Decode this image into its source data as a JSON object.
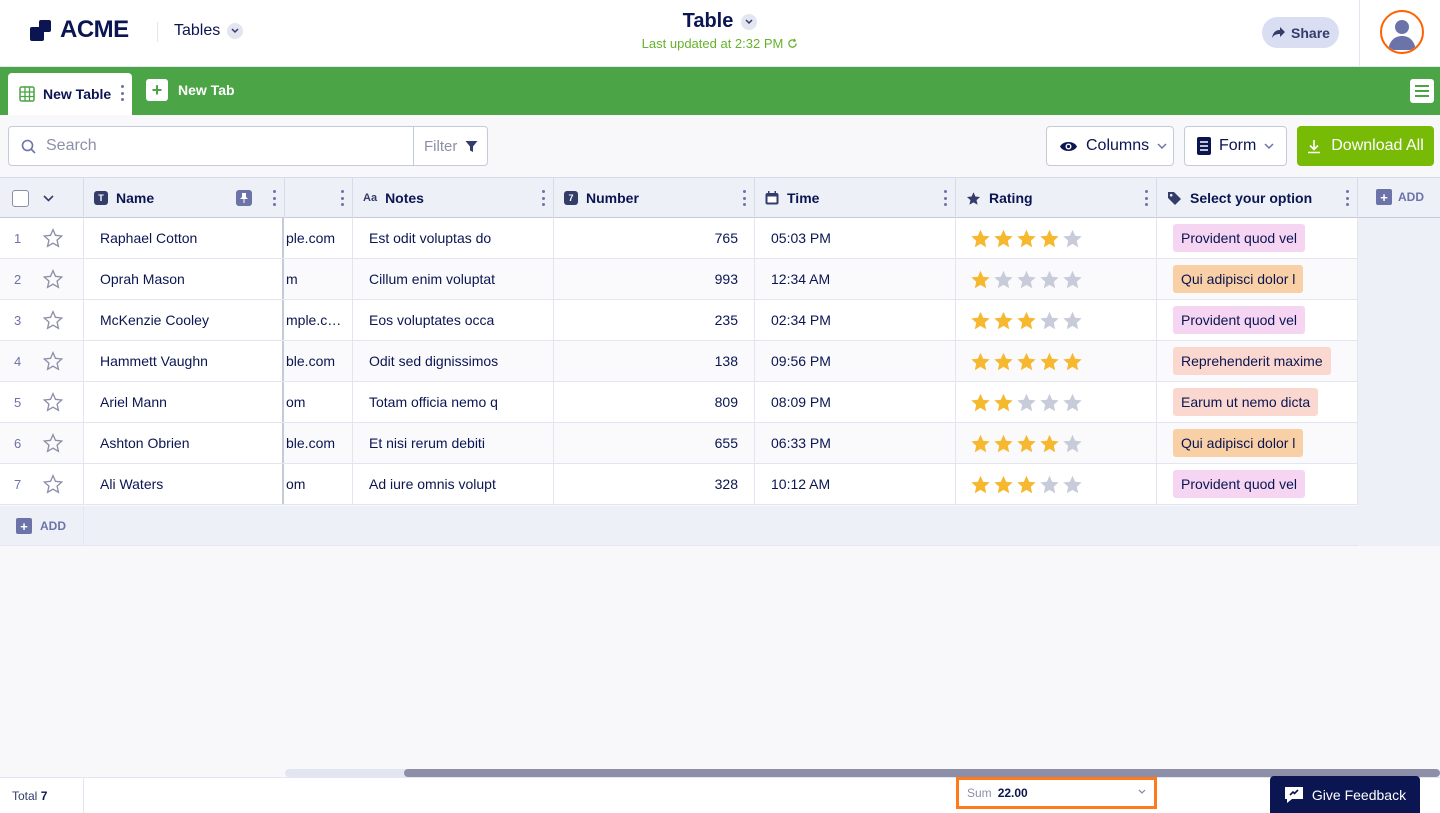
{
  "app": {
    "brand": "ACME",
    "section_label": "Tables",
    "title": "Table",
    "last_updated": "Last updated at 2:32 PM",
    "share_label": "Share"
  },
  "tabs": {
    "active_label": "New Table",
    "new_tab_label": "New Tab"
  },
  "toolbar": {
    "search_placeholder": "Search",
    "filter_label": "Filter",
    "columns_label": "Columns",
    "form_label": "Form",
    "download_label": "Download All"
  },
  "columns": {
    "name": "Name",
    "notes": "Notes",
    "number": "Number",
    "time": "Time",
    "rating": "Rating",
    "option": "Select your option",
    "add": "ADD"
  },
  "rows": [
    {
      "num": "1",
      "name": "Raphael Cotton",
      "email": "ple.com",
      "notes": "Est odit voluptas do",
      "number": "765",
      "time": "05:03 PM",
      "rating": 4,
      "option": "Provident quod vel",
      "option_color": "#f6d5f2"
    },
    {
      "num": "2",
      "name": "Oprah Mason",
      "email": "m",
      "notes": "Cillum enim voluptat",
      "number": "993",
      "time": "12:34 AM",
      "rating": 1,
      "option": "Qui adipisci dolor l",
      "option_color": "#f9cfa5"
    },
    {
      "num": "3",
      "name": "McKenzie Cooley",
      "email": "mple.c…",
      "notes": "Eos voluptates occa",
      "number": "235",
      "time": "02:34 PM",
      "rating": 3,
      "option": "Provident quod vel",
      "option_color": "#f6d5f2"
    },
    {
      "num": "4",
      "name": "Hammett Vaughn",
      "email": "ble.com",
      "notes": "Odit sed dignissimos",
      "number": "138",
      "time": "09:56 PM",
      "rating": 5,
      "option": "Reprehenderit maxime",
      "option_color": "#fbd8cf"
    },
    {
      "num": "5",
      "name": "Ariel Mann",
      "email": "om",
      "notes": "Totam officia nemo q",
      "number": "809",
      "time": "08:09 PM",
      "rating": 2,
      "option": "Earum ut nemo dicta",
      "option_color": "#fbd8cf"
    },
    {
      "num": "6",
      "name": "Ashton Obrien",
      "email": "ble.com",
      "notes": "Et nisi rerum debiti",
      "number": "655",
      "time": "06:33 PM",
      "rating": 4,
      "option": "Qui adipisci dolor l",
      "option_color": "#f9cfa5"
    },
    {
      "num": "7",
      "name": "Ali Waters",
      "email": "om",
      "notes": "Ad iure omnis volupt",
      "number": "328",
      "time": "10:12 AM",
      "rating": 3,
      "option": "Provident quod vel",
      "option_color": "#f6d5f2"
    }
  ],
  "add_row_label": "ADD",
  "footer": {
    "total_label": "Total",
    "total_value": "7",
    "sum_label": "Sum",
    "sum_value": "22.00",
    "feedback_label": "Give Feedback"
  },
  "colors": {
    "brand_green": "#4ba445",
    "download_green": "#78bb07",
    "star_filled": "#f5b82e",
    "star_empty": "#c8cbd9",
    "highlight_orange": "#ff7a1a",
    "navy": "#0a1551"
  },
  "icons": {
    "search": "search-icon",
    "filter": "filter-icon",
    "eye": "eye-icon",
    "form": "form-icon",
    "download": "download-icon",
    "star": "star-icon"
  }
}
